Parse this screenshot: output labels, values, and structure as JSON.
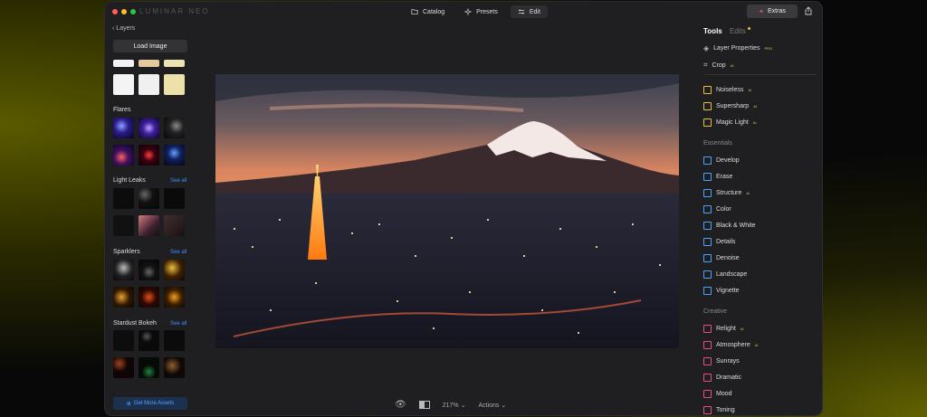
{
  "app": {
    "brand": "LUMINAR NEO"
  },
  "nav": {
    "catalog": "Catalog",
    "presets": "Presets",
    "edit": "Edit",
    "extras": "Extras"
  },
  "left": {
    "back": "Layers",
    "load_image": "Load Image",
    "sections": {
      "flares": "Flares",
      "light_leaks": "Light Leaks",
      "sparklers": "Sparklers",
      "stardust": "Stardust Bokeh"
    },
    "see_all": "See all",
    "get_more": "Get More Assets"
  },
  "right": {
    "tabs": {
      "tools": "Tools",
      "edits": "Edits"
    },
    "top_tools": [
      {
        "label": "Layer Properties",
        "badge": "PRO"
      },
      {
        "label": "Crop",
        "badge": "AI"
      }
    ],
    "ai_tools": [
      {
        "label": "Noiseless",
        "badge": "AI",
        "color": "#e8c040"
      },
      {
        "label": "Supersharp",
        "badge": "AI",
        "color": "#e8c040"
      },
      {
        "label": "Magic Light",
        "badge": "AI",
        "color": "#e8c040"
      }
    ],
    "essentials_title": "Essentials",
    "essentials": [
      {
        "label": "Develop",
        "badge": "",
        "color": "#4aa3ff"
      },
      {
        "label": "Erase",
        "badge": "",
        "color": "#4aa3ff"
      },
      {
        "label": "Structure",
        "badge": "AI",
        "color": "#4aa3ff"
      },
      {
        "label": "Color",
        "badge": "",
        "color": "#4aa3ff"
      },
      {
        "label": "Black & White",
        "badge": "",
        "color": "#4aa3ff"
      },
      {
        "label": "Details",
        "badge": "",
        "color": "#4aa3ff"
      },
      {
        "label": "Denoise",
        "badge": "",
        "color": "#4aa3ff"
      },
      {
        "label": "Landscape",
        "badge": "",
        "color": "#4aa3ff"
      },
      {
        "label": "Vignette",
        "badge": "",
        "color": "#4aa3ff"
      }
    ],
    "creative_title": "Creative",
    "creative": [
      {
        "label": "Relight",
        "badge": "AI",
        "color": "#e84c8c"
      },
      {
        "label": "Atmosphere",
        "badge": "AI",
        "color": "#e84c8c"
      },
      {
        "label": "Sunrays",
        "badge": "",
        "color": "#e84c8c"
      },
      {
        "label": "Dramatic",
        "badge": "",
        "color": "#e84c8c"
      },
      {
        "label": "Mood",
        "badge": "",
        "color": "#e84c8c"
      },
      {
        "label": "Toning",
        "badge": "",
        "color": "#e84c8c"
      }
    ]
  },
  "bottom": {
    "zoom": "217%",
    "actions": "Actions"
  }
}
